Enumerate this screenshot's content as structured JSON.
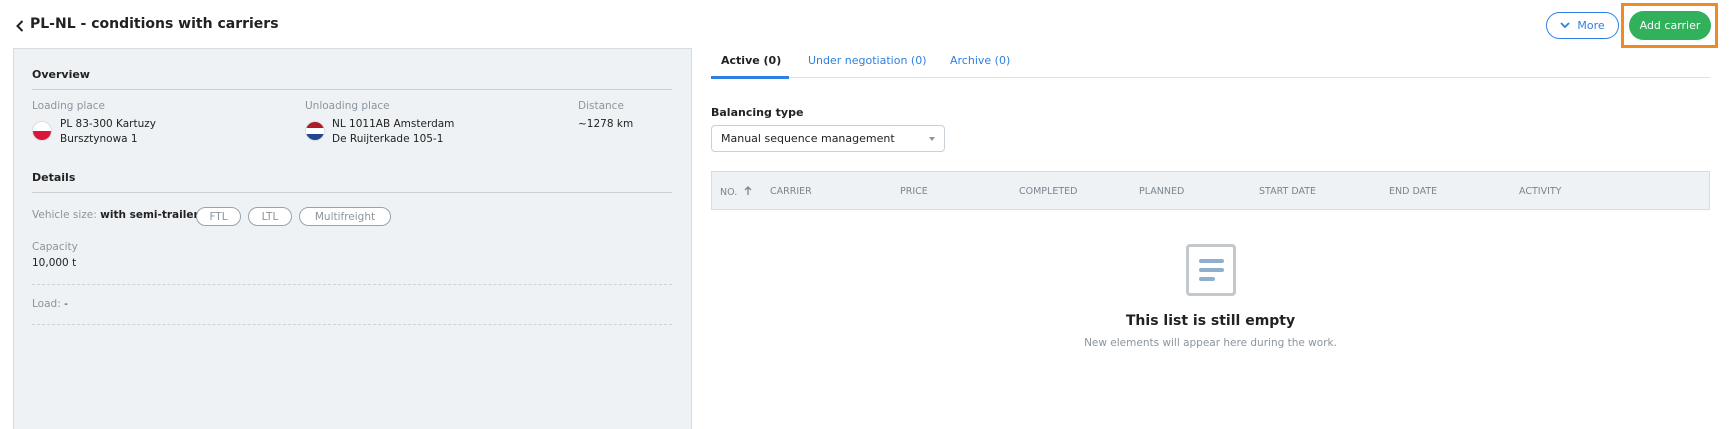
{
  "header": {
    "title": "PL-NL - conditions with carriers",
    "more_label": "More",
    "add_label": "Add carrier"
  },
  "overview": {
    "title": "Overview",
    "loading": {
      "label": "Loading place",
      "line1": "PL 83-300 Kartuzy",
      "line2": "Bursztynowa 1"
    },
    "unloading": {
      "label": "Unloading place",
      "line1": "NL 1011AB Amsterdam",
      "line2": "De Ruijterkade 105-1"
    },
    "distance": {
      "label": "Distance",
      "value": "~1278 km"
    }
  },
  "details": {
    "title": "Details",
    "vehicle_label": "Vehicle size:",
    "vehicle_value": "with semi-trailer",
    "chips": [
      "FTL",
      "LTL",
      "Multifreight"
    ],
    "capacity_label": "Capacity",
    "capacity_value": "10,000 t",
    "load_label": "Load:",
    "load_value": "-"
  },
  "tabs": [
    "Active (0)",
    "Under negotiation (0)",
    "Archive (0)"
  ],
  "balancing": {
    "label": "Balancing type",
    "value": "Manual sequence management"
  },
  "table": {
    "columns": [
      "NO.",
      "CARRIER",
      "PRICE",
      "COMPLETED",
      "PLANNED",
      "START DATE",
      "END DATE",
      "ACTIVITY"
    ]
  },
  "empty": {
    "title": "This list is still empty",
    "subtitle": "New elements will appear here during the work."
  },
  "colors": {
    "accent": "#2f7fe0",
    "add_button": "#31b15b",
    "highlight": "#f08a24",
    "panel_bg": "#eef2f5"
  },
  "icons": {
    "back": "chevron-left-icon",
    "more": "chevron-down-icon",
    "sort": "arrow-up-icon",
    "empty": "document-list-icon",
    "poland_flag": "poland-flag-icon",
    "netherlands_flag": "netherlands-flag-icon"
  }
}
